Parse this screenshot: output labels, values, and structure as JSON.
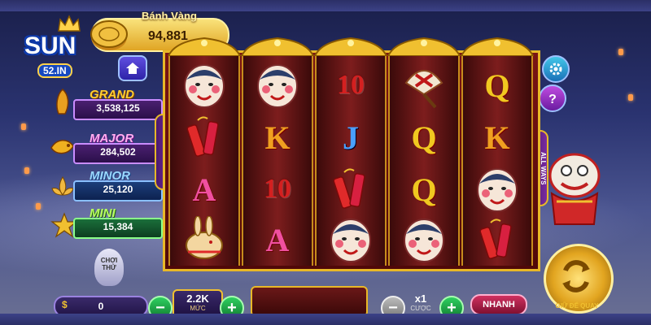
{
  "balance": {
    "title": "Bánh Vàng",
    "value": "94,881"
  },
  "logo": {
    "main": "SUN",
    "sub": "52.IN"
  },
  "jackpots": [
    {
      "name": "GRAND",
      "value": "3,538,125"
    },
    {
      "name": "MAJOR",
      "value": "284,502"
    },
    {
      "name": "MINOR",
      "value": "25,120"
    },
    {
      "name": "MINI",
      "value": "15,384"
    }
  ],
  "reels_side_label": "ALL WAYS",
  "reels": [
    [
      "mask",
      "firecracker",
      "A",
      "rabbit-lantern"
    ],
    [
      "mask",
      "K",
      "10",
      "A"
    ],
    [
      "10",
      "J",
      "firecracker",
      "mask"
    ],
    [
      "fan",
      "Q",
      "Q",
      "mask"
    ],
    [
      "Q",
      "K",
      "mask",
      "firecracker"
    ]
  ],
  "controls": {
    "win_value": "0",
    "bet_value": "2.2K",
    "bet_label": "MỨC",
    "lines_value": "x1",
    "lines_label": "CƯỢC",
    "fast_label": "NHANH",
    "spin_label": "GIỮ ĐỂ QUAY",
    "trial_label": "CHƠI THỬ"
  },
  "colors": {
    "gold": "#e8b828",
    "reel_bg": "#7a1414",
    "accent_green": "#2ed060"
  }
}
